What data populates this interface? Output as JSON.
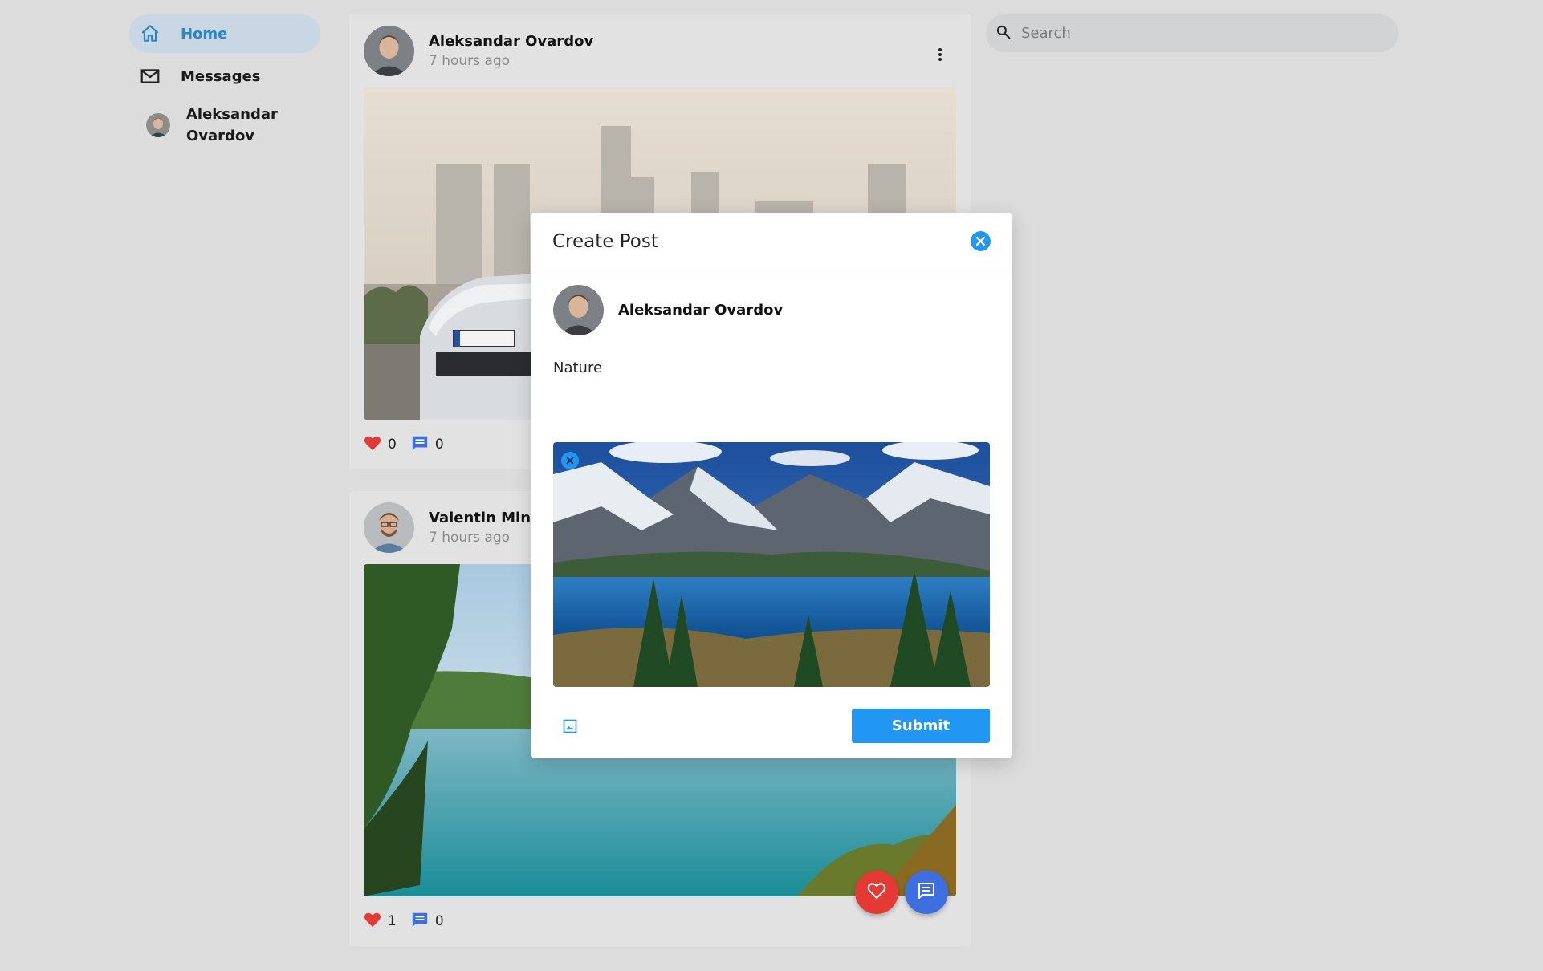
{
  "sidebar": {
    "items": [
      {
        "label": "Home",
        "icon": "home-icon",
        "active": true
      },
      {
        "label": "Messages",
        "icon": "mail-icon",
        "active": false
      }
    ],
    "profile_name": "Aleksandar Ovardov"
  },
  "posts": [
    {
      "author": "Aleksandar Ovardov",
      "time": "7 hours ago",
      "likes": "0",
      "comments": "0",
      "image": "city-skyline-car-photo"
    },
    {
      "author": "Valentin Mink",
      "time": "7 hours ago",
      "likes": "1",
      "comments": "0",
      "image": "lake-forest-photo"
    }
  ],
  "search": {
    "placeholder": "Search"
  },
  "modal": {
    "title": "Create Post",
    "author": "Aleksandar Ovardov",
    "post_text": "Nature",
    "preview_image": "mountain-lake-photo",
    "submit_label": "Submit"
  },
  "colors": {
    "accent": "#2196f3",
    "like": "#e53935",
    "comment": "#3d6fe0",
    "background": "#dcdcdc"
  }
}
